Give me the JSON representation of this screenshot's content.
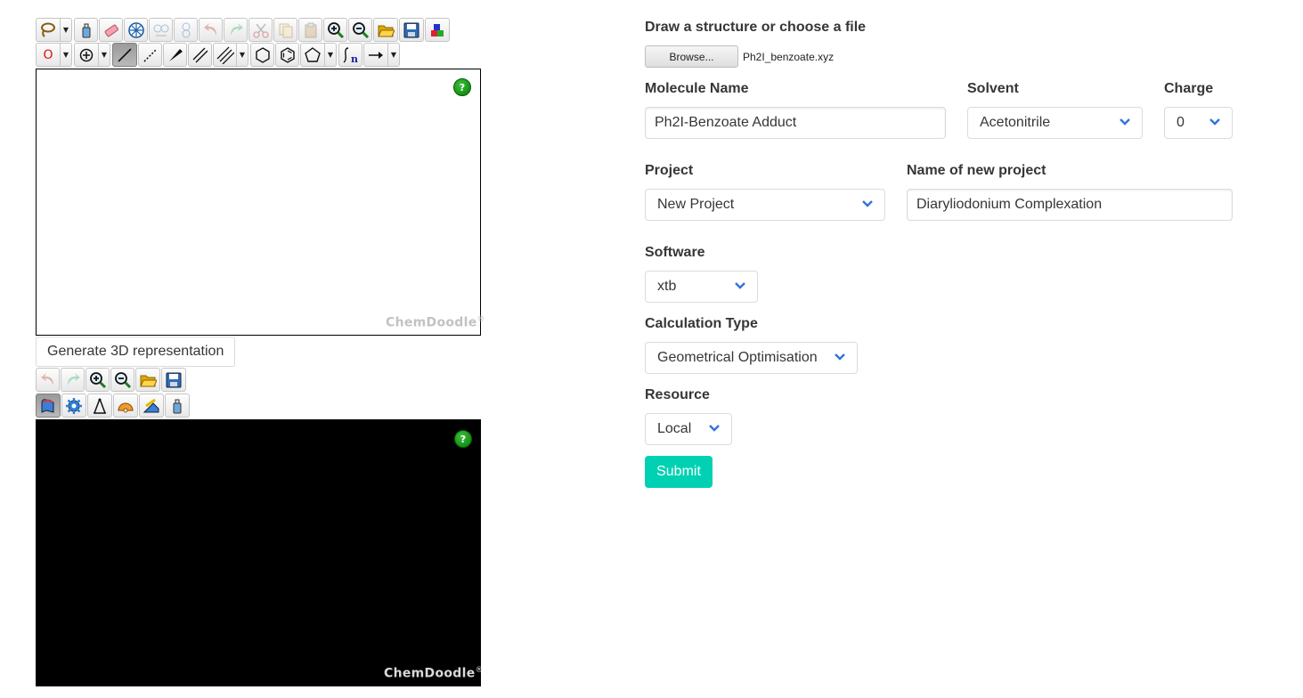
{
  "sketcher": {
    "watermark": "ChemDoodle",
    "watermark_mark": "®",
    "help": "?",
    "element_value": "O",
    "toolbar_row1": [
      "lasso-icon",
      "eraser-bottle-icon",
      "eraser-icon",
      "center-icon",
      "flip-horizontal-icon",
      "flip-vertical-icon",
      "undo-icon",
      "redo-icon",
      "cut-icon",
      "copy-icon",
      "paste-icon",
      "zoom-in-icon",
      "zoom-out-icon",
      "open-icon",
      "save-icon",
      "templates-icon"
    ],
    "toolbar_row2": [
      "element-icon",
      "charge-icon",
      "single-bond-icon",
      "dashed-bond-icon",
      "wedge-bond-icon",
      "double-bond-icon",
      "triple-bond-icon",
      "cyclohexane-icon",
      "benzene-icon",
      "pentagon-icon",
      "repeat-unit-icon",
      "arrow-icon"
    ]
  },
  "generate_3d_label": "Generate 3D representation",
  "viewer": {
    "watermark": "ChemDoodle",
    "watermark_mark": "®",
    "help": "?",
    "toolbar_row1": [
      "undo-icon",
      "redo-icon",
      "zoom-in-icon",
      "zoom-out-icon",
      "open-icon",
      "save-icon"
    ],
    "toolbar_row2": [
      "rotate-icon",
      "settings-icon",
      "distance-icon",
      "angle-icon",
      "torsion-icon",
      "clear-icon"
    ]
  },
  "form": {
    "file_label": "Draw a structure or choose a file",
    "browse_label": "Browse...",
    "file_name": "Ph2I_benzoate.xyz",
    "molecule_name_label": "Molecule Name",
    "molecule_name_value": "Ph2I-Benzoate Adduct",
    "solvent_label": "Solvent",
    "solvent_value": "Acetonitrile",
    "charge_label": "Charge",
    "charge_value": "0",
    "project_label": "Project",
    "project_value": "New Project",
    "new_project_label": "Name of new project",
    "new_project_value": "Diaryliodonium Complexation",
    "software_label": "Software",
    "software_value": "xtb",
    "calc_type_label": "Calculation Type",
    "calc_type_value": "Geometrical Optimisation",
    "resource_label": "Resource",
    "resource_value": "Local",
    "submit_label": "Submit"
  },
  "colors": {
    "accent": "#00d1b2",
    "chevron": "#3273dc",
    "text": "#363636",
    "help_green": "#0a8a0a"
  }
}
